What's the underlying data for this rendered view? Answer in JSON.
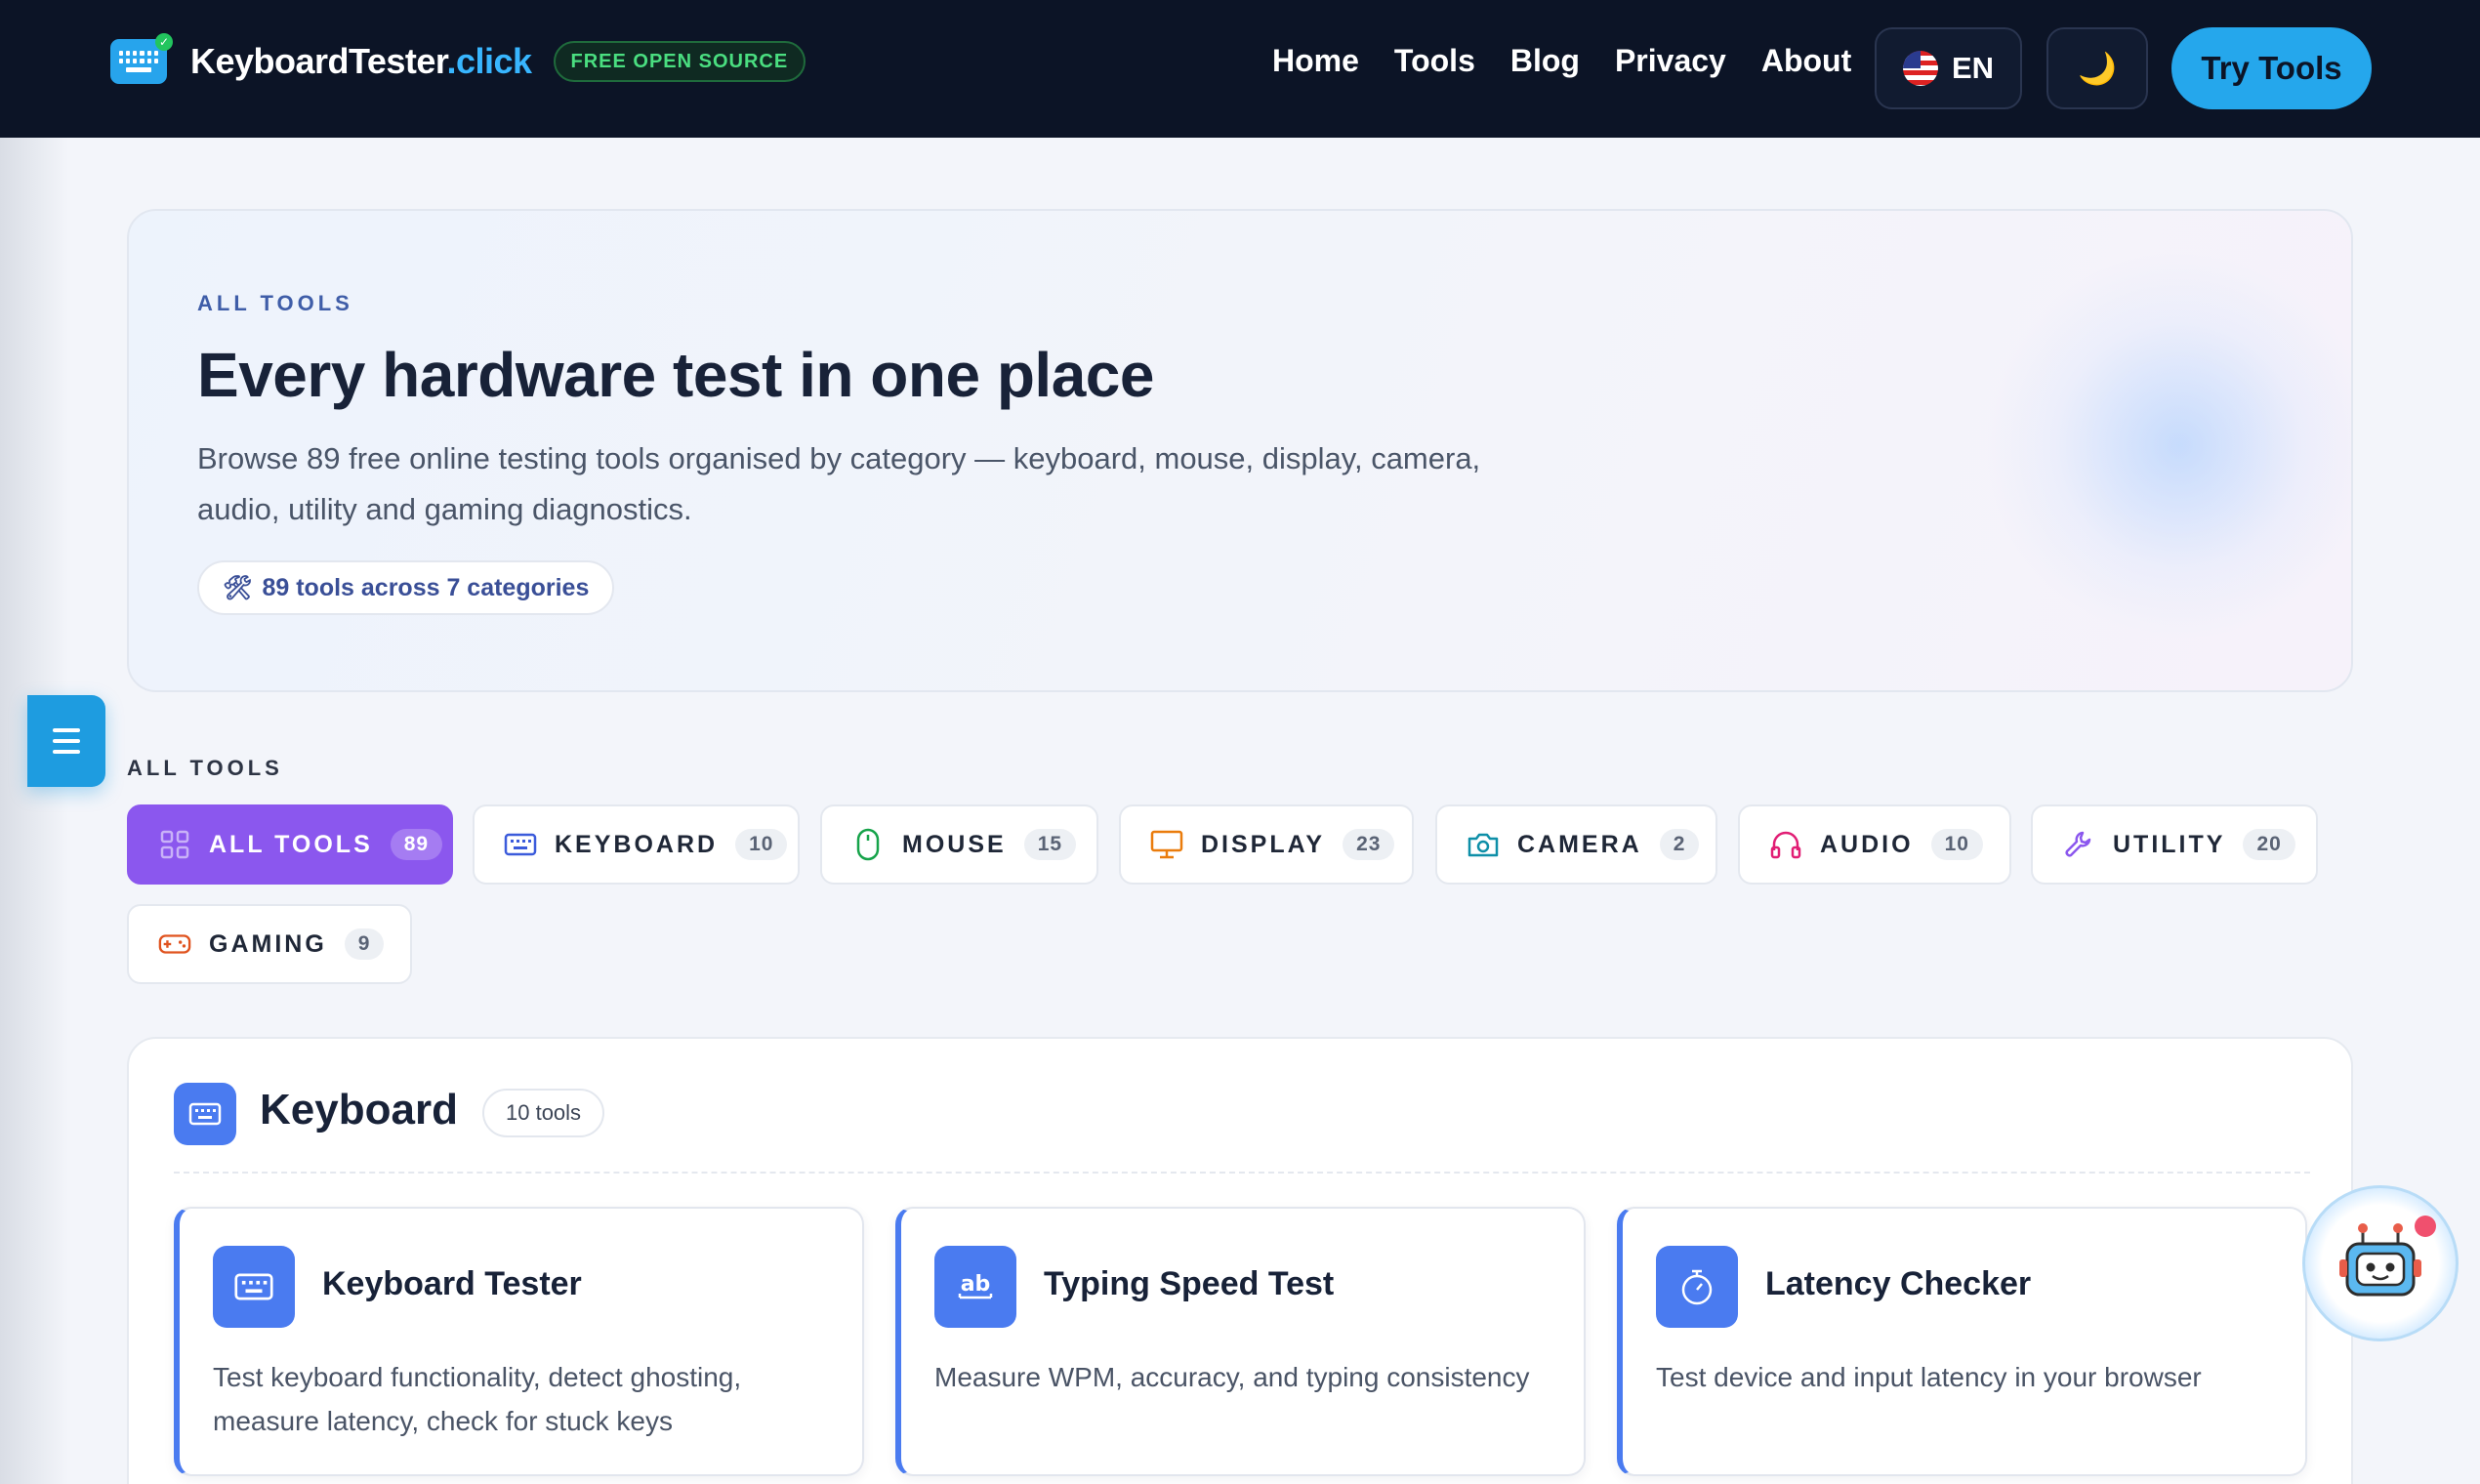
{
  "header": {
    "brand_main": "KeyboardTester",
    "brand_accent": ".click",
    "badge": "FREE OPEN SOURCE",
    "nav": [
      "Home",
      "Tools",
      "Blog",
      "Privacy",
      "About"
    ],
    "lang": "EN",
    "theme_icon": "moon-icon",
    "cta": "Try Tools"
  },
  "hero": {
    "eyebrow": "ALL TOOLS",
    "title": "Every hardware test in one place",
    "description": "Browse 89 free online testing tools organised by category — keyboard, mouse, display, camera, audio, utility and gaming diagnostics.",
    "pill": "89 tools across 7 categories"
  },
  "filters": {
    "label": "ALL TOOLS",
    "chips": [
      {
        "label": "ALL TOOLS",
        "count": "89",
        "icon": "grid-icon",
        "color": "#ffffff"
      },
      {
        "label": "KEYBOARD",
        "count": "10",
        "icon": "keyboard-icon",
        "color": "#3b5bdb"
      },
      {
        "label": "MOUSE",
        "count": "15",
        "icon": "mouse-icon",
        "color": "#16a34a"
      },
      {
        "label": "DISPLAY",
        "count": "23",
        "icon": "monitor-icon",
        "color": "#ea7c0c"
      },
      {
        "label": "CAMERA",
        "count": "2",
        "icon": "camera-icon",
        "color": "#0e8fa8"
      },
      {
        "label": "AUDIO",
        "count": "10",
        "icon": "headphones-icon",
        "color": "#e11d74"
      },
      {
        "label": "UTILITY",
        "count": "20",
        "icon": "wrench-icon",
        "color": "#8b57ee"
      },
      {
        "label": "GAMING",
        "count": "9",
        "icon": "gamepad-icon",
        "color": "#e0531f"
      }
    ],
    "active_color": "#8b57ee"
  },
  "keyboard_section": {
    "title": "Keyboard",
    "count": "10 tools",
    "cards": [
      {
        "title": "Keyboard Tester",
        "desc": "Test keyboard functionality, detect ghosting, measure latency, check for stuck keys",
        "icon": "keyboard-icon"
      },
      {
        "title": "Typing Speed Test",
        "desc": "Measure WPM, accuracy, and typing consistency",
        "icon": "ab-text-icon"
      },
      {
        "title": "Latency Checker",
        "desc": "Test device and input latency in your browser",
        "icon": "stopwatch-icon"
      }
    ]
  },
  "colors": {
    "nav_bg": "#0c1426",
    "accent_blue": "#25a7ec",
    "card_blue": "#4a7bf0"
  }
}
